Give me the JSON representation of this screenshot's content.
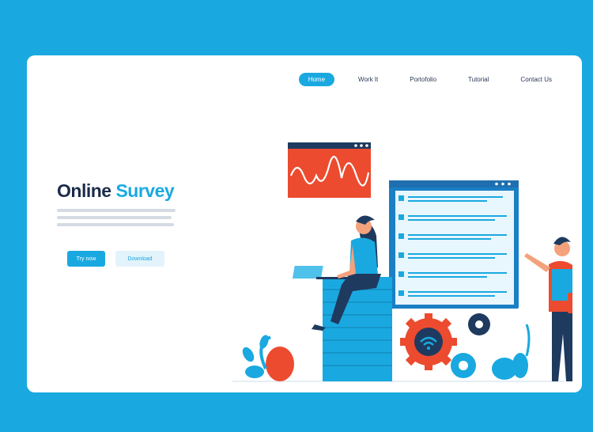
{
  "nav": {
    "items": [
      {
        "label": "Home",
        "active": true
      },
      {
        "label": "Work It",
        "active": false
      },
      {
        "label": "Portofolio",
        "active": false
      },
      {
        "label": "Tutorial",
        "active": false
      },
      {
        "label": "Contact Us",
        "active": false
      }
    ]
  },
  "hero": {
    "title_main": "Online",
    "title_accent": "Survey",
    "try_button": "Try now",
    "download_button": "Download"
  },
  "colors": {
    "background": "#19a9e0",
    "accent": "#19a9e0",
    "title": "#1c2b4a",
    "chart_red": "#ec4b2f",
    "navy": "#1f3a5f"
  },
  "icons": [
    "wave-chart-icon",
    "survey-form-icon",
    "wifi-gear-icon",
    "laptop-icon",
    "plant-icon"
  ]
}
